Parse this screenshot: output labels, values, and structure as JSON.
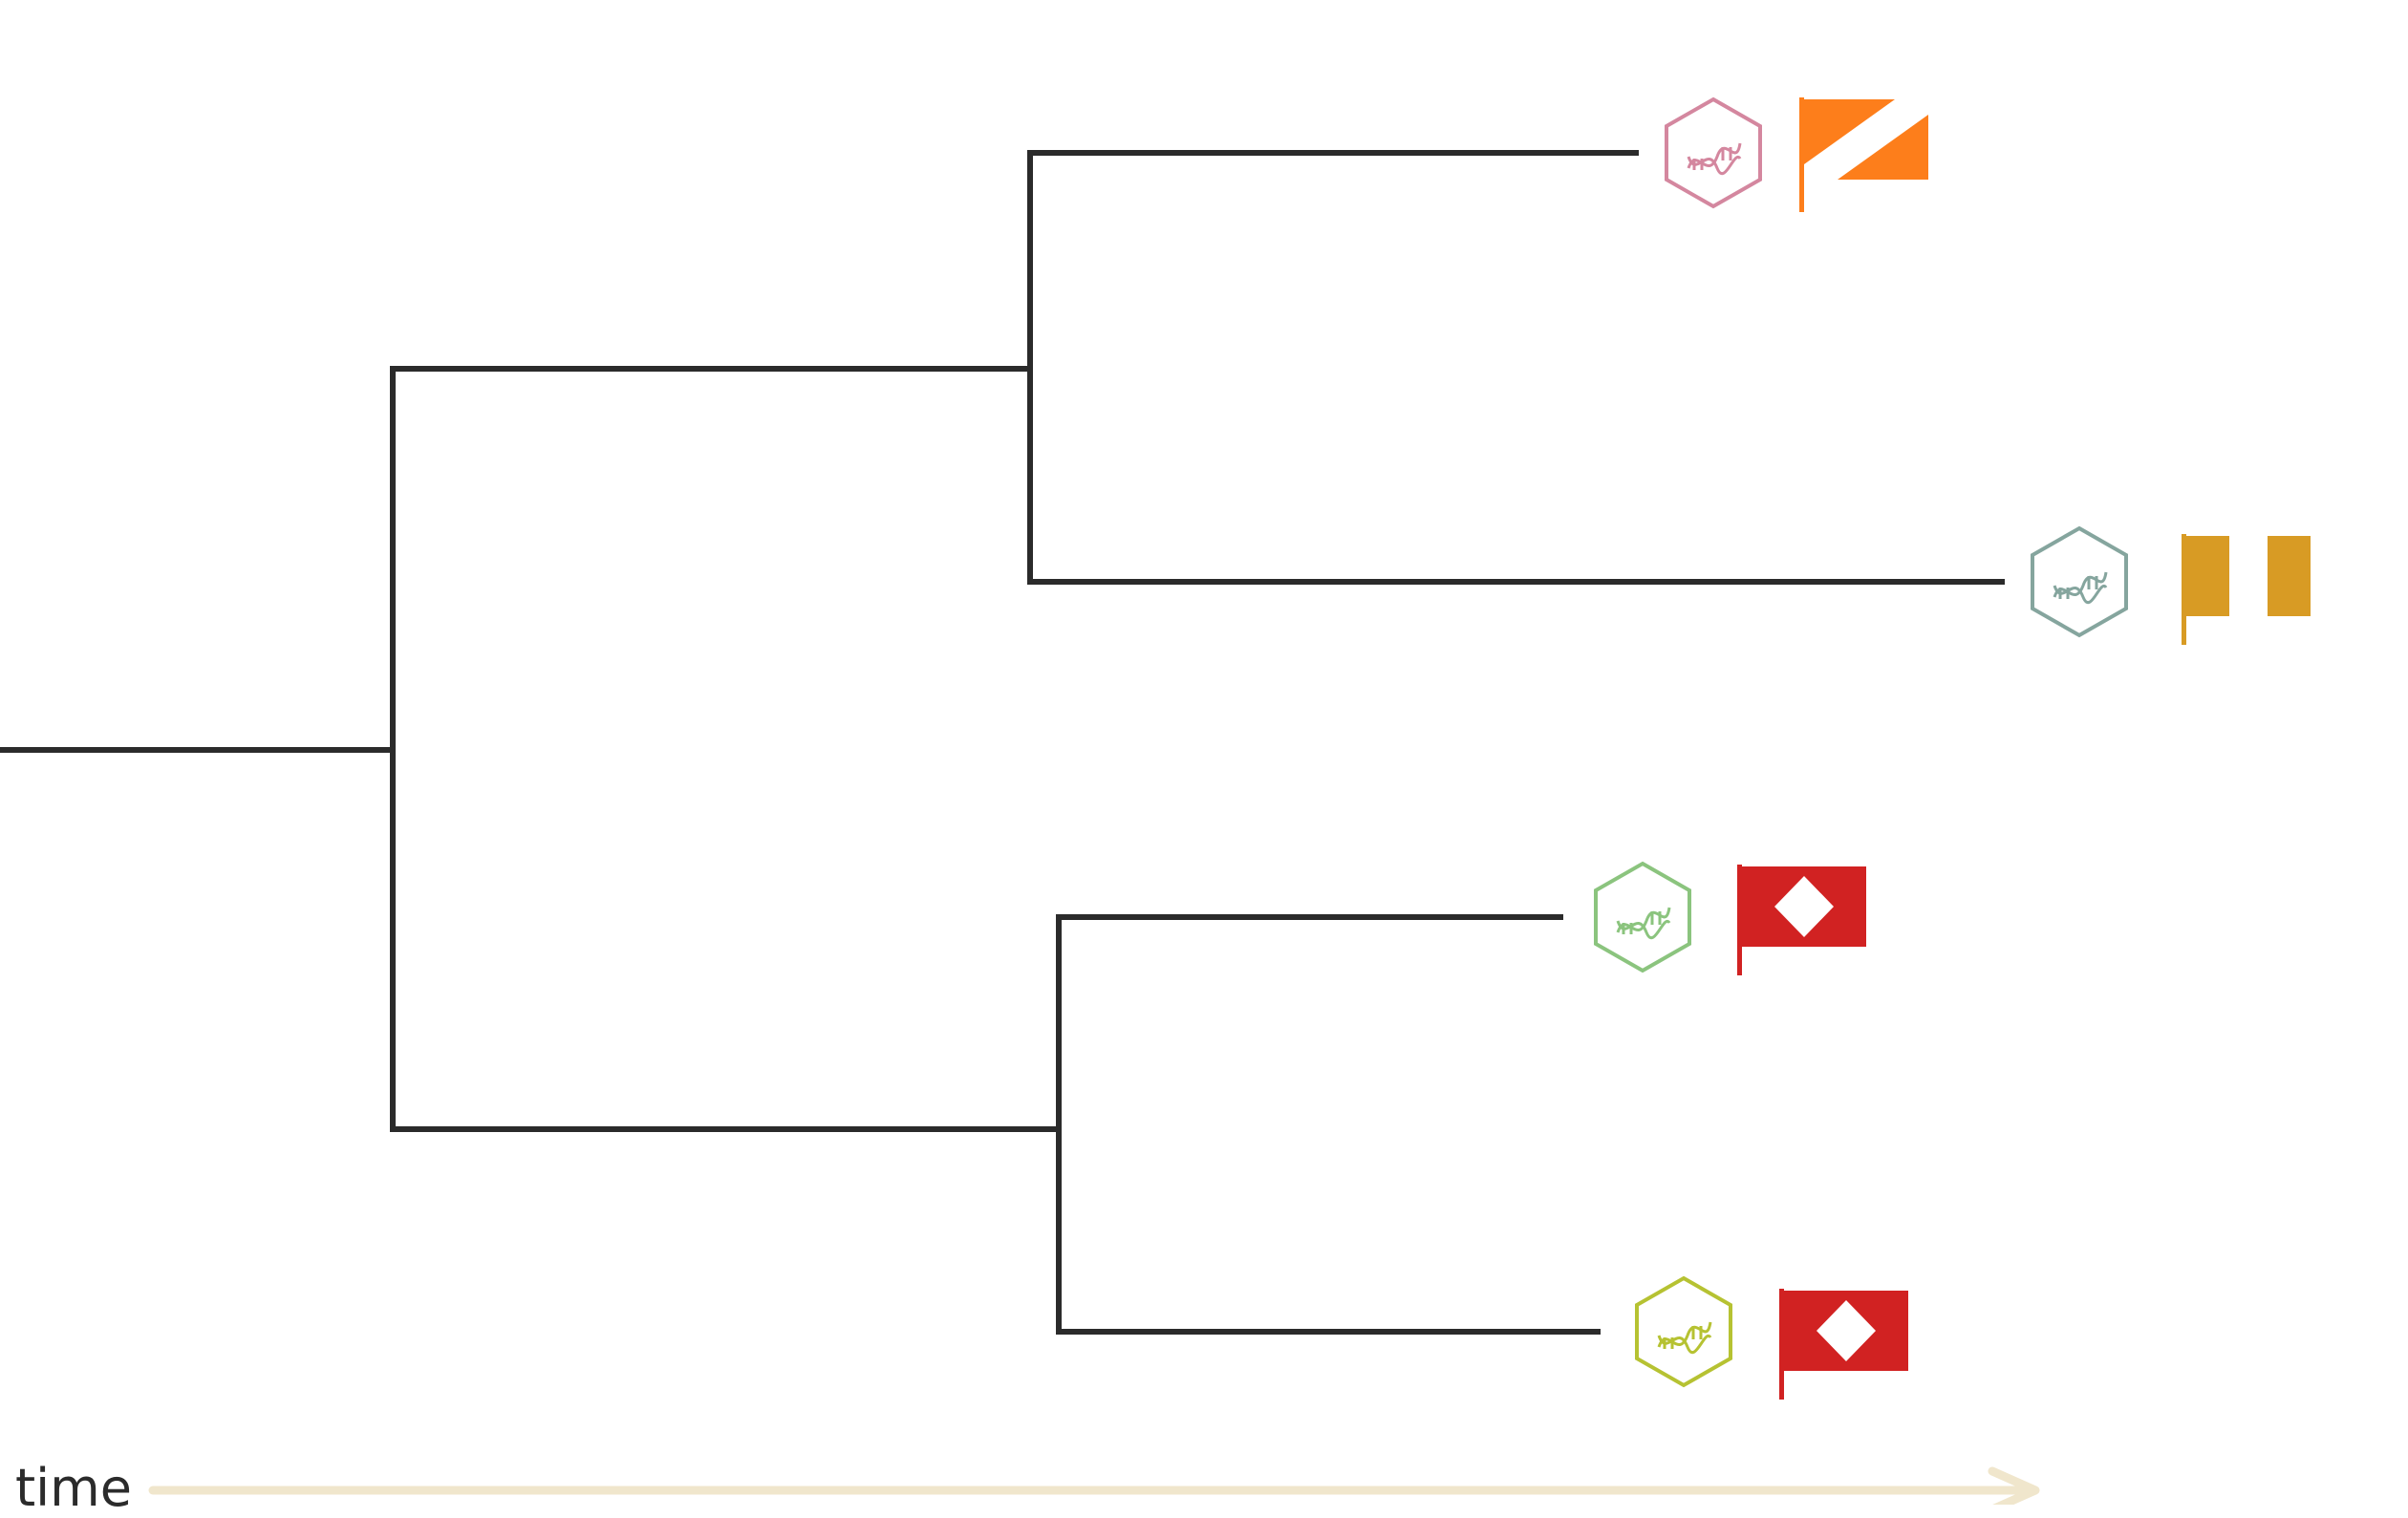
{
  "tree": {
    "branch_color": "#2b2b2b",
    "leaves": [
      {
        "hex_color": "#d4879f",
        "hex_icon": "dna-icon",
        "flag_icon": "diagonal-stripe-flag-icon",
        "flag_color": "#fd7e1b"
      },
      {
        "hex_color": "#85a59e",
        "hex_icon": "dna-icon",
        "flag_icon": "vertical-tricolor-flag-icon",
        "flag_color": "#d89b24"
      },
      {
        "hex_color": "#8bc47e",
        "hex_icon": "dna-icon",
        "flag_icon": "diamond-flag-icon",
        "flag_color": "#d12222"
      },
      {
        "hex_color": "#b6c232",
        "hex_icon": "dna-icon",
        "flag_icon": "diamond-flag-icon",
        "flag_color": "#d12222"
      }
    ]
  },
  "axis": {
    "label": "time",
    "arrow_color": "#f0e6cc"
  }
}
